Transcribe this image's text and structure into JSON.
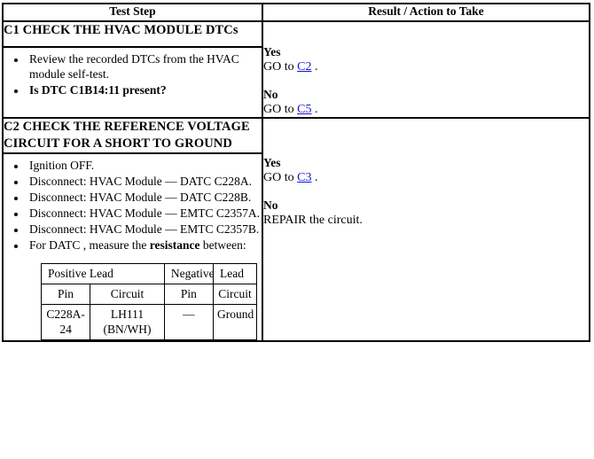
{
  "document": {
    "type": "diagnostic-pinpoint-test-table"
  },
  "table": {
    "headers": {
      "test_step": "Test Step",
      "result_action": "Result / Action to Take"
    },
    "steps": [
      {
        "id": "C1",
        "title": "C1 CHECK THE HVAC MODULE DTCs",
        "bullets": [
          {
            "text": "Review the recorded DTCs from the HVAC module self-test.",
            "bold": false
          },
          {
            "text": "Is DTC C1B14:11 present?",
            "bold": true
          }
        ],
        "result": {
          "yes_label": "Yes",
          "yes_action_prefix": "GO to ",
          "yes_link": "C2",
          "yes_action_suffix": " .",
          "no_label": "No",
          "no_action_prefix": "GO to ",
          "no_link": "C5",
          "no_action_suffix": " ."
        }
      },
      {
        "id": "C2",
        "title": "C2 CHECK THE REFERENCE VOLTAGE CIRCUIT FOR A SHORT TO GROUND",
        "bullets": [
          {
            "text": "Ignition OFF.",
            "bold": false
          },
          {
            "text": "Disconnect: HVAC Module — DATC C228A.",
            "bold": false
          },
          {
            "text": "Disconnect: HVAC Module — DATC C228B.",
            "bold": false
          },
          {
            "text": "Disconnect: HVAC Module — EMTC C2357A.",
            "bold": false
          },
          {
            "text": "Disconnect: HVAC Module — EMTC C2357B.",
            "bold": false
          }
        ],
        "measure_bullet": {
          "prefix": "For DATC , measure the ",
          "bold_word": "resistance",
          "suffix": " between:"
        },
        "measurement_table": {
          "group_headers": {
            "positive_lead": "Positive Lead",
            "negative": "Negative",
            "lead": "Lead"
          },
          "column_headers": {
            "pos_pin": "Pin",
            "pos_circuit": "Circuit",
            "neg_pin": "Pin",
            "neg_circuit": "Circuit"
          },
          "rows": [
            {
              "pos_pin": "C228A-24",
              "pos_circuit": "LH111 (BN/WH)",
              "neg_pin": "—",
              "neg_circuit": "Ground"
            }
          ]
        },
        "result": {
          "yes_label": "Yes",
          "yes_action_prefix": "GO to ",
          "yes_link": "C3",
          "yes_action_suffix": " .",
          "no_label": "No",
          "no_action_prefix": "REPAIR the circuit.",
          "no_link": "",
          "no_action_suffix": ""
        }
      }
    ]
  },
  "colors": {
    "link": "#1414cf",
    "border": "#000000",
    "text": "#000000",
    "background": "#ffffff"
  }
}
